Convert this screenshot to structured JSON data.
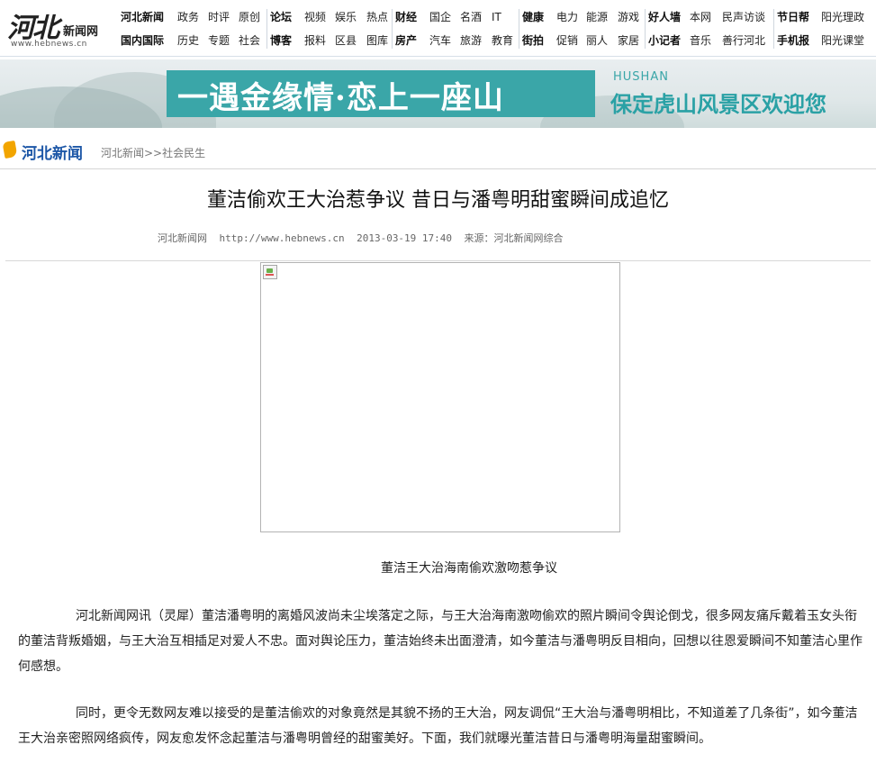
{
  "logo": {
    "mark": "河北",
    "name": "新闻网",
    "url": "www.hebnews.cn"
  },
  "nav": {
    "row1": [
      {
        "label": "河北新闻",
        "bold": true
      },
      {
        "label": "政务"
      },
      {
        "label": "时评"
      },
      {
        "label": "原创"
      },
      {
        "label": "论坛",
        "bold": true
      },
      {
        "label": "视频"
      },
      {
        "label": "娱乐"
      },
      {
        "label": "热点"
      },
      {
        "label": "财经",
        "bold": true
      },
      {
        "label": "国企"
      },
      {
        "label": "名酒"
      },
      {
        "label": "IT"
      },
      {
        "label": "健康",
        "bold": true
      },
      {
        "label": "电力"
      },
      {
        "label": "能源"
      },
      {
        "label": "游戏"
      },
      {
        "label": "好人墙",
        "bold": true
      },
      {
        "label": "本网"
      },
      {
        "label": "民声访谈"
      },
      {
        "label": "节日帮",
        "bold": true
      },
      {
        "label": "阳光理政"
      }
    ],
    "row2": [
      {
        "label": "国内国际",
        "bold": true
      },
      {
        "label": "历史"
      },
      {
        "label": "专题"
      },
      {
        "label": "社会"
      },
      {
        "label": "博客",
        "bold": true
      },
      {
        "label": "报料"
      },
      {
        "label": "区县"
      },
      {
        "label": "图库"
      },
      {
        "label": "房产",
        "bold": true
      },
      {
        "label": "汽车"
      },
      {
        "label": "旅游"
      },
      {
        "label": "教育"
      },
      {
        "label": "街拍",
        "bold": true
      },
      {
        "label": "促销"
      },
      {
        "label": "丽人"
      },
      {
        "label": "家居"
      },
      {
        "label": "小记者",
        "bold": true
      },
      {
        "label": "音乐"
      },
      {
        "label": "善行河北"
      },
      {
        "label": "手机报",
        "bold": true
      },
      {
        "label": "阳光课堂"
      }
    ]
  },
  "banner": {
    "slogan": "一遇金缘情·恋上一座山",
    "brand": "HUSHAN",
    "welcome": "保定虎山风景区欢迎您",
    "accent": "#3aa6a8"
  },
  "breadcrumb": {
    "site_logo": "河北新闻",
    "path": "河北新闻>>社会民生"
  },
  "article": {
    "title": "董洁偷欢王大治惹争议 昔日与潘粤明甜蜜瞬间成追忆",
    "meta": {
      "site": "河北新闻网",
      "url": "http://www.hebnews.cn",
      "time": "2013-03-19 17:40",
      "source": "来源：河北新闻网综合"
    },
    "image_caption": "董洁王大治海南偷欢激吻惹争议",
    "paragraphs": [
      "河北新闻网讯（灵犀）董洁潘粤明的离婚风波尚未尘埃落定之际，与王大治海南激吻偷欢的照片瞬间令舆论倒戈，很多网友痛斥戴着玉女头衔的董洁背叛婚姻，与王大治互相插足对爱人不忠。面对舆论压力，董洁始终未出面澄清，如今董洁与潘粤明反目相向，回想以往恩爱瞬间不知董洁心里作何感想。",
      "同时，更令无数网友难以接受的是董洁偷欢的对象竟然是其貌不扬的王大治，网友调侃“王大治与潘粤明相比，不知道差了几条街”，如今董洁王大治亲密照网络疯传，网友愈发怀念起董洁与潘粤明曾经的甜蜜美好。下面，我们就曝光董洁昔日与潘粤明海量甜蜜瞬间。"
    ]
  }
}
